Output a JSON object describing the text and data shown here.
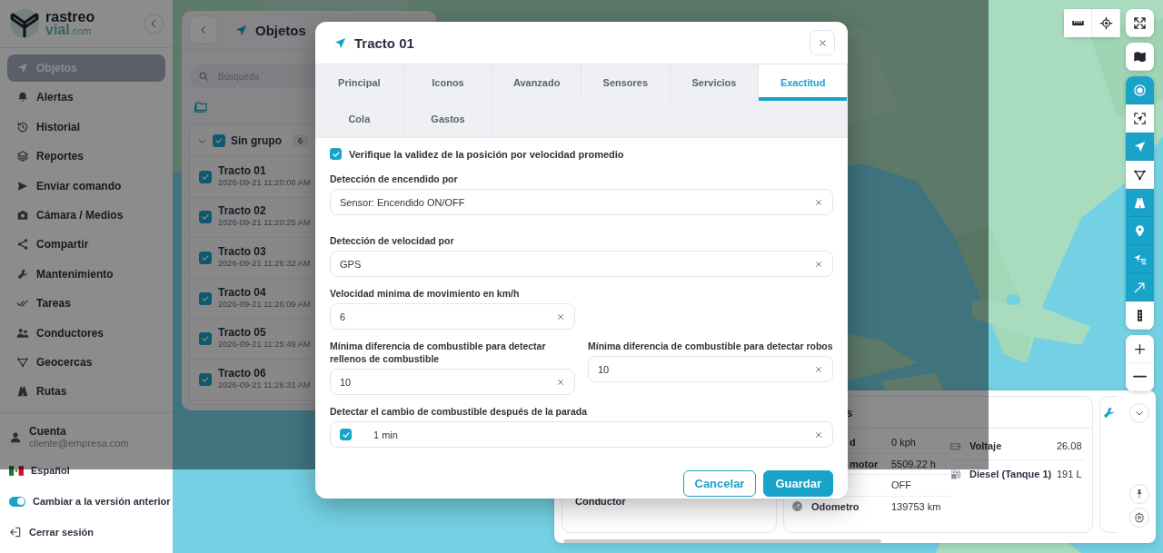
{
  "sidebar": {
    "logo": {
      "line1": "rastreo",
      "line2": "vial",
      "suffix": ".com"
    },
    "items": [
      {
        "label": "Objetos",
        "selected": true
      },
      {
        "label": "Alertas",
        "selected": false
      },
      {
        "label": "Historial",
        "selected": false
      },
      {
        "label": "Reportes",
        "selected": false
      },
      {
        "label": "Enviar comando",
        "selected": false
      },
      {
        "label": "Cámara / Medios",
        "selected": false
      },
      {
        "label": "Compartir",
        "selected": false
      },
      {
        "label": "Mantenimiento",
        "selected": false
      },
      {
        "label": "Tareas",
        "selected": false
      },
      {
        "label": "Conductores",
        "selected": false
      },
      {
        "label": "Geocercas",
        "selected": false
      },
      {
        "label": "Rutas",
        "selected": false
      }
    ],
    "account": {
      "label": "Cuenta",
      "email": "cliente@empresa.com"
    },
    "language": "Español",
    "legacy_toggle": {
      "label": "Cambiar a la versión anterior",
      "on": true
    },
    "logout": "Cerrar sesión"
  },
  "objects_panel": {
    "title": "Objetos",
    "search": {
      "placeholder": "Búsqueda"
    },
    "group": {
      "name": "Sin grupo",
      "count": "6",
      "checked": true,
      "expanded": true
    },
    "items": [
      {
        "name": "Tracto 01",
        "time": "2026-09-21 11:20:06 AM",
        "checked": true
      },
      {
        "name": "Tracto 02",
        "time": "2026-09-21 11:20:25 AM",
        "checked": true
      },
      {
        "name": "Tracto 03",
        "time": "2026-09-21 11:26:32 AM",
        "checked": true
      },
      {
        "name": "Tracto 04",
        "time": "2026-09-21 11:26:09 AM",
        "checked": true
      },
      {
        "name": "Tracto 05",
        "time": "2026-09-21 11:25:49 AM",
        "checked": true
      },
      {
        "name": "Tracto 06",
        "time": "2026-09-21 11:26:31 AM",
        "checked": true
      }
    ]
  },
  "map_toolbar": {
    "measure": [
      {
        "kind": "ruler"
      },
      {
        "kind": "locate"
      }
    ],
    "fullscreen": {
      "kind": "fullscreen"
    },
    "map_type": {
      "kind": "map"
    },
    "layers": [
      {
        "kind": "cluster",
        "on": true
      },
      {
        "kind": "fit",
        "on": false
      },
      {
        "kind": "objects",
        "on": true
      },
      {
        "kind": "geofences",
        "on": false
      },
      {
        "kind": "routes",
        "on": true
      },
      {
        "kind": "markers",
        "on": true
      },
      {
        "kind": "tails",
        "on": true
      },
      {
        "kind": "arrows",
        "on": true
      },
      {
        "kind": "traffic",
        "on": false
      }
    ],
    "zoom": [
      {
        "kind": "zoom_in"
      },
      {
        "kind": "zoom_out"
      }
    ]
  },
  "info_panel": {
    "driver_label": "Conductor",
    "sensor_card": {
      "title": "s",
      "left_rows": [
        {
          "kind": "plain",
          "label": "d",
          "value": "0 kph",
          "clipped": true
        },
        {
          "kind": "plain",
          "label": "motor",
          "value": "5509.22 h",
          "clipped": true
        },
        {
          "kind": "plain",
          "value": "OFF"
        },
        {
          "kind": "odometer",
          "label": "Odometro",
          "value": "139753 km"
        }
      ],
      "right_rows": [
        {
          "kind": "voltage",
          "label": "Voltaje",
          "value": "26.08"
        },
        {
          "kind": "fuel",
          "label": "Diesel (Tanque 1)",
          "value": "191 L"
        }
      ]
    }
  },
  "dialog": {
    "title": "Tracto 01",
    "tabs": [
      {
        "label": "Principal",
        "selected": false
      },
      {
        "label": "Iconos",
        "selected": false
      },
      {
        "label": "Avanzado",
        "selected": false
      },
      {
        "label": "Sensores",
        "selected": false
      },
      {
        "label": "Servicios",
        "selected": false
      },
      {
        "label": "Exactitud",
        "selected": true
      },
      {
        "label": "Cola",
        "selected": false
      },
      {
        "label": "Gastos",
        "selected": false
      }
    ],
    "fields": [
      {
        "kind": "checkbox",
        "label": "Verifique la validez de la posición por velocidad promedio",
        "checked": true
      },
      {
        "kind": "select",
        "label": "Detección de encendido por",
        "value": "Sensor: Encendido ON/OFF"
      },
      {
        "kind": "select",
        "label": "Detección de velocidad por",
        "value": "GPS"
      },
      {
        "kind": "half",
        "label": "Velocidad minima de movimiento en km/h",
        "value": "6"
      },
      {
        "kind": "pair",
        "fields": [
          {
            "label": "Mínima diferencia de combustible para detectar rellenos de combustible",
            "value": "10"
          },
          {
            "label": "Mínima diferencia de combustible para detectar robos",
            "value": "10"
          }
        ]
      },
      {
        "kind": "check_select",
        "label": "Detectar el cambio de combustible después de la parada",
        "checked": true,
        "value": "1 min"
      }
    ],
    "buttons": {
      "cancel": "Cancelar",
      "save": "Guardar"
    }
  }
}
